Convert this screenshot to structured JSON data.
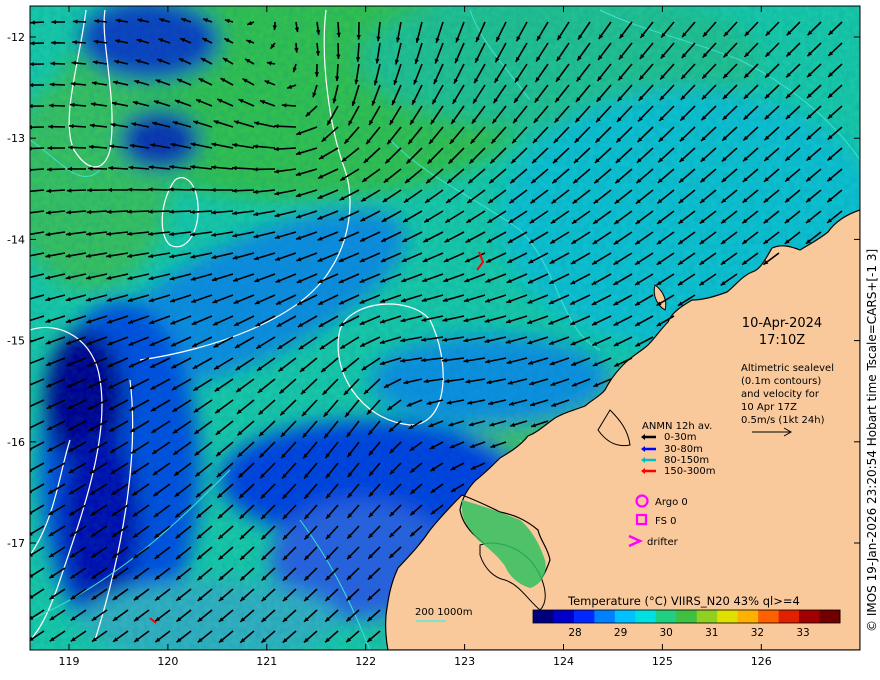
{
  "map": {
    "lon_ticks": [
      "119",
      "120",
      "121",
      "122",
      "123",
      "124",
      "125",
      "126"
    ],
    "lat_ticks": [
      "-12",
      "-13",
      "-14",
      "-15",
      "-16",
      "-17"
    ]
  },
  "annotation": {
    "date": "10-Apr-2024",
    "time": "17:10Z",
    "desc_lines": [
      "Altimetric sealevel",
      "(0.1m contours)",
      "and velocity for",
      "10 Apr 17Z",
      "0.5m/s (1kt 24h)"
    ]
  },
  "legend": {
    "title": "ANMN 12h av.",
    "items": [
      {
        "label": "0-30m",
        "color": "#000000"
      },
      {
        "label": "30-80m",
        "color": "#0000ff"
      },
      {
        "label": "80-150m",
        "color": "#00c0c0"
      },
      {
        "label": "150-300m",
        "color": "#ff0000"
      }
    ],
    "argo": "Argo 0",
    "fs": "FS 0",
    "drifter": "drifter",
    "marker_color": "#ff00ff"
  },
  "bathy": {
    "label": "200  1000m",
    "color": "#00ffff"
  },
  "colorbar": {
    "title": "Temperature (°C) VIIRS_N20 43% ql>=4",
    "ticks": [
      "28",
      "29",
      "30",
      "31",
      "32",
      "33"
    ],
    "colors": [
      "#00007f",
      "#0000c8",
      "#0028ff",
      "#0080ff",
      "#00c0ff",
      "#00e0e0",
      "#20d080",
      "#40c040",
      "#90d020",
      "#e0e000",
      "#ffb000",
      "#ff6000",
      "#e02000",
      "#a00000",
      "#700000"
    ]
  },
  "credit": "© IMOS 19-Jan-2026 23:20:54 Hobart time Tscale=CARS+[-1 3]",
  "colors": {
    "land": "#f9c99c",
    "coast": "#000000",
    "contour": "#ffffff",
    "bathy": "#40e0d0"
  }
}
